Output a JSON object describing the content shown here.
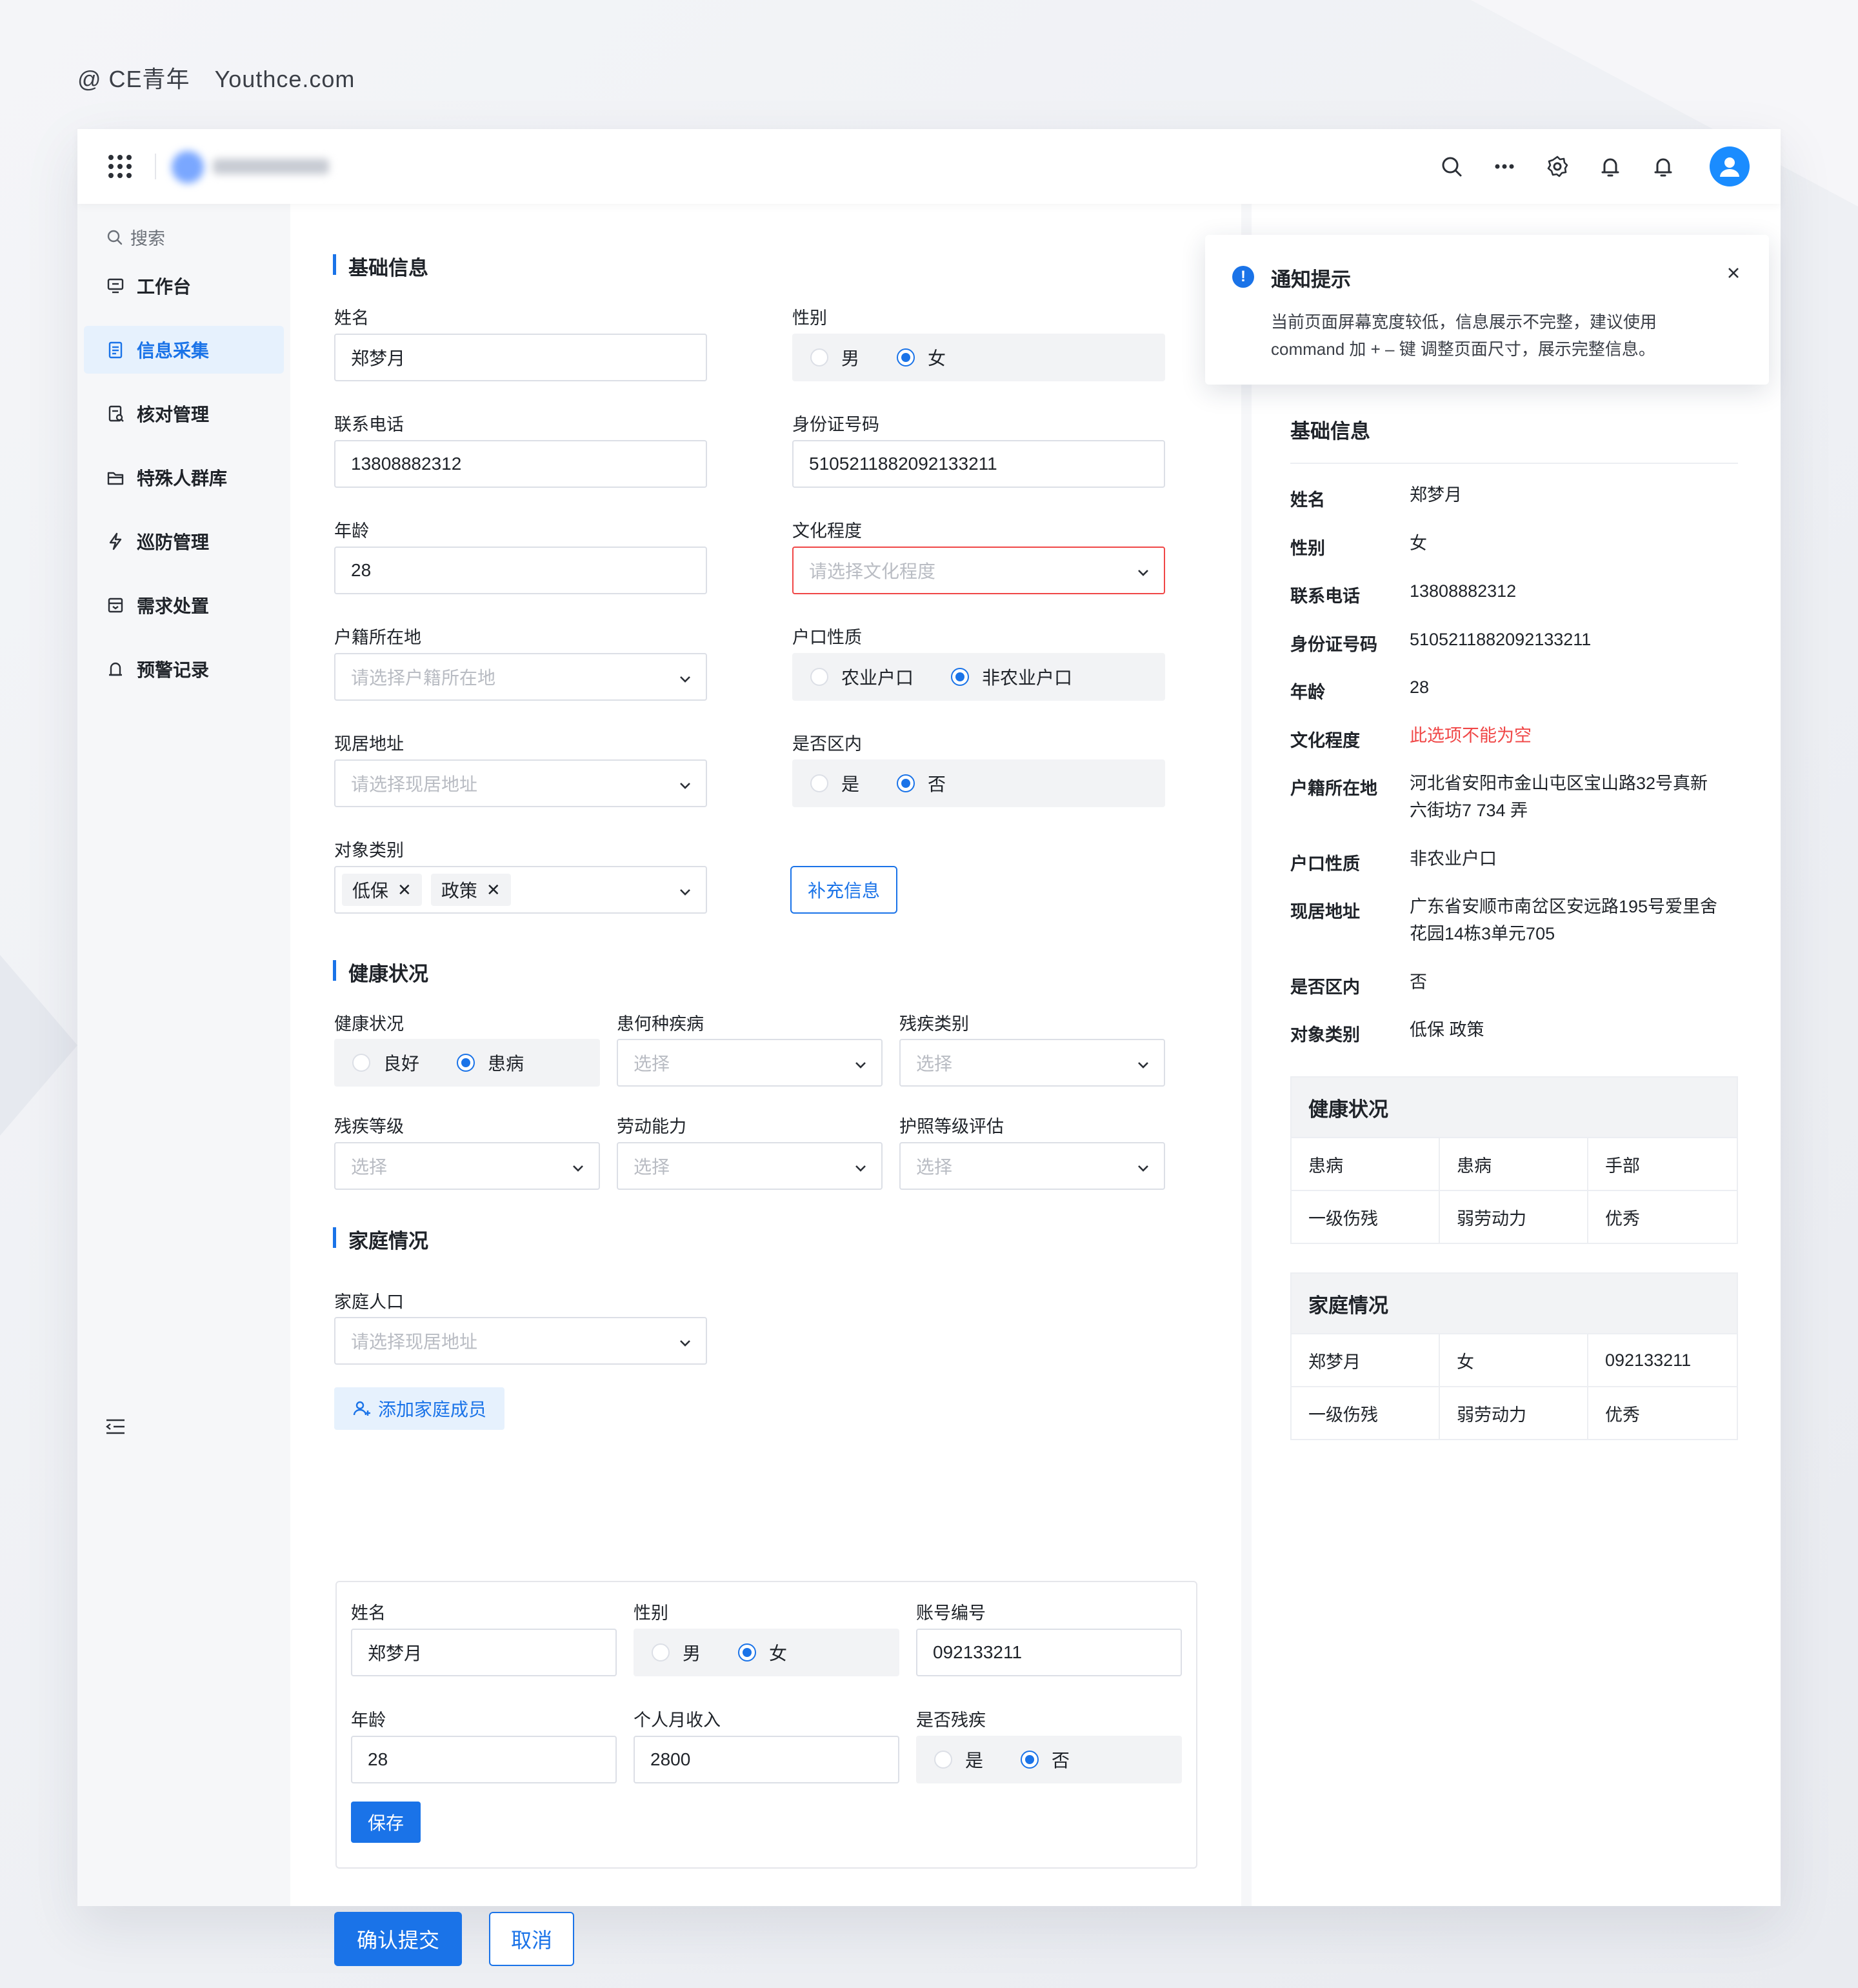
{
  "watermark": {
    "handle": "@ CE青年",
    "site": "Youthce.com"
  },
  "sidebar": {
    "search_label": "搜索",
    "items": [
      {
        "label": "工作台",
        "icon": "monitor-icon"
      },
      {
        "label": "信息采集",
        "icon": "clipboard-icon",
        "active": true
      },
      {
        "label": "核对管理",
        "icon": "check-doc-icon"
      },
      {
        "label": "特殊人群库",
        "icon": "folder-icon"
      },
      {
        "label": "巡防管理",
        "icon": "bolt-icon"
      },
      {
        "label": "需求处置",
        "icon": "inbox-icon"
      },
      {
        "label": "预警记录",
        "icon": "alarm-icon"
      }
    ]
  },
  "form": {
    "basic_title": "基础信息",
    "name_label": "姓名",
    "name_value": "郑梦月",
    "gender_label": "性别",
    "gender_options": [
      "男",
      "女"
    ],
    "gender_selected": "女",
    "phone_label": "联系电话",
    "phone_value": "13808882312",
    "id_label": "身份证号码",
    "id_value": "510521188209213321​1",
    "age_label": "年龄",
    "age_value": "28",
    "edu_label": "文化程度",
    "edu_placeholder": "请选择文化程度",
    "huji_label": "户籍所在地",
    "huji_placeholder": "请选择户籍所在地",
    "hukou_label": "户口性质",
    "hukou_options": [
      "农业户口",
      "非农业户口"
    ],
    "hukou_selected": "非农业户口",
    "addr_label": "现居地址",
    "addr_placeholder": "请选择现居地址",
    "inarea_label": "是否区内",
    "inarea_options": [
      "是",
      "否"
    ],
    "inarea_selected": "否",
    "type_label": "对象类别",
    "type_tags": [
      "低保",
      "政策"
    ],
    "supplement_button": "补充信息",
    "health_title": "健康状况",
    "health_label": "健康状况",
    "health_options": [
      "良好",
      "患病"
    ],
    "health_selected": "患病",
    "disease_label": "患何种疾病",
    "disease_placeholder": "选择",
    "disab_type_label": "残疾类别",
    "disab_type_placeholder": "选择",
    "disab_level_label": "残疾等级",
    "disab_level_placeholder": "选择",
    "labor_label": "劳动能力",
    "labor_placeholder": "选择",
    "care_label": "护照等级评估",
    "care_placeholder": "选择",
    "family_title": "家庭情况",
    "family_pop_label": "家庭人口",
    "family_pop_placeholder": "请选择现居地址",
    "add_member_button": "添加家庭成员",
    "member": {
      "name_label": "姓名",
      "name_value": "郑梦月",
      "gender_label": "性别",
      "gender_options": [
        "男",
        "女"
      ],
      "gender_selected": "女",
      "account_label": "账号编号",
      "account_value": "092133211",
      "age_label": "年龄",
      "age_value": "28",
      "income_label": "个人月收入",
      "income_value": "2800",
      "disabled_label": "是否残疾",
      "disabled_options": [
        "是",
        "否"
      ],
      "disabled_selected": "否",
      "save_button": "保存"
    },
    "submit_button": "确认提交",
    "cancel_button": "取消"
  },
  "notification": {
    "title": "通知提示",
    "line1": "当前页面屏幕宽度较低，信息展示不完整，建议使用",
    "line2": "command 加 + – 键 调整页面尺寸，展示完整信息。"
  },
  "summary": {
    "title": "基础信息",
    "rows": [
      {
        "key": "姓名",
        "value": "郑梦月"
      },
      {
        "key": "性别",
        "value": "女"
      },
      {
        "key": "联系电话",
        "value": "13808882312"
      },
      {
        "key": "身份证号码",
        "value": "5105211882092133211"
      },
      {
        "key": "年龄",
        "value": "28"
      },
      {
        "key": "文化程度",
        "value": "此选项不能为空",
        "error": true
      },
      {
        "key": "户籍所在地",
        "value": "河北省安阳市金山屯区宝山路32号真新",
        "value2": "六街坊7 734 弄"
      },
      {
        "key": "户口性质",
        "value": "非农业户口"
      },
      {
        "key": "现居地址",
        "value": "广东省安顺市南岔区安远路195号爱里舍",
        "value2": "花园14栋3单元705"
      },
      {
        "key": "是否区内",
        "value": "否"
      },
      {
        "key": "对象类别",
        "value": "低保 政策"
      }
    ],
    "health_table": {
      "title": "健康状况",
      "rows": [
        [
          "患病",
          "患病",
          "手部"
        ],
        [
          "一级伤残",
          "弱劳动力",
          "优秀"
        ]
      ]
    },
    "family_table": {
      "title": "家庭情况",
      "rows": [
        [
          "郑梦月",
          "女",
          "092133211"
        ],
        [
          "一级伤残",
          "弱劳动力",
          "优秀"
        ]
      ]
    }
  },
  "colors": {
    "primary": "#1a73e8",
    "error": "#f04747",
    "avatar": "#1a8cff"
  }
}
